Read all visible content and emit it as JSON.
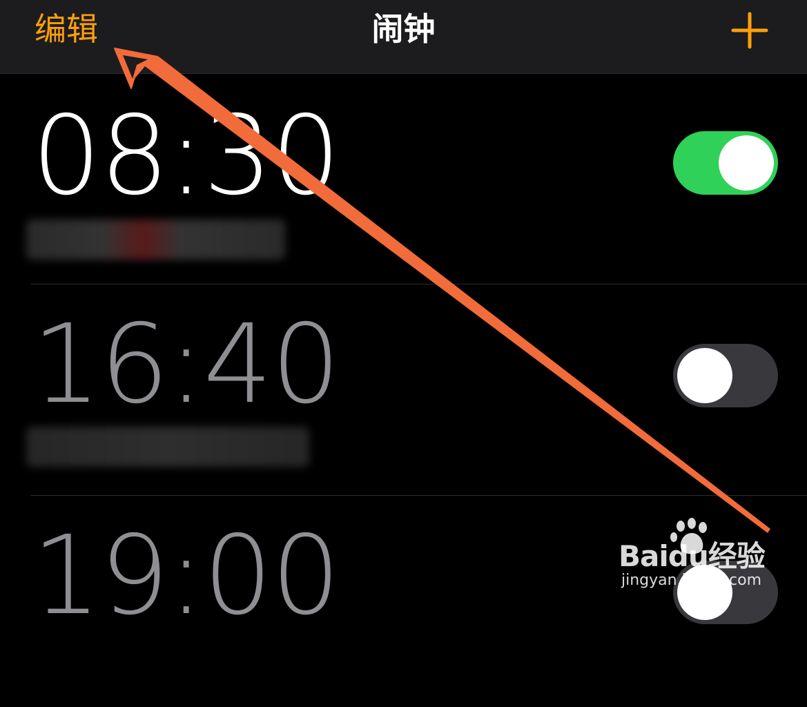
{
  "navbar": {
    "edit_label": "编辑",
    "title": "闹钟",
    "add_icon": "plus-icon"
  },
  "alarms": [
    {
      "time": "08:30",
      "enabled": true
    },
    {
      "time": "16:40",
      "enabled": false
    },
    {
      "time": "19:00",
      "enabled": false
    }
  ],
  "watermark": {
    "brand": "Baidu经验",
    "url": "jingyan.baidu.com"
  },
  "colors": {
    "accent": "#ff9f0a",
    "toggle_on": "#30d158",
    "toggle_off": "#39393d",
    "annotation_arrow": "#f26b3a"
  }
}
